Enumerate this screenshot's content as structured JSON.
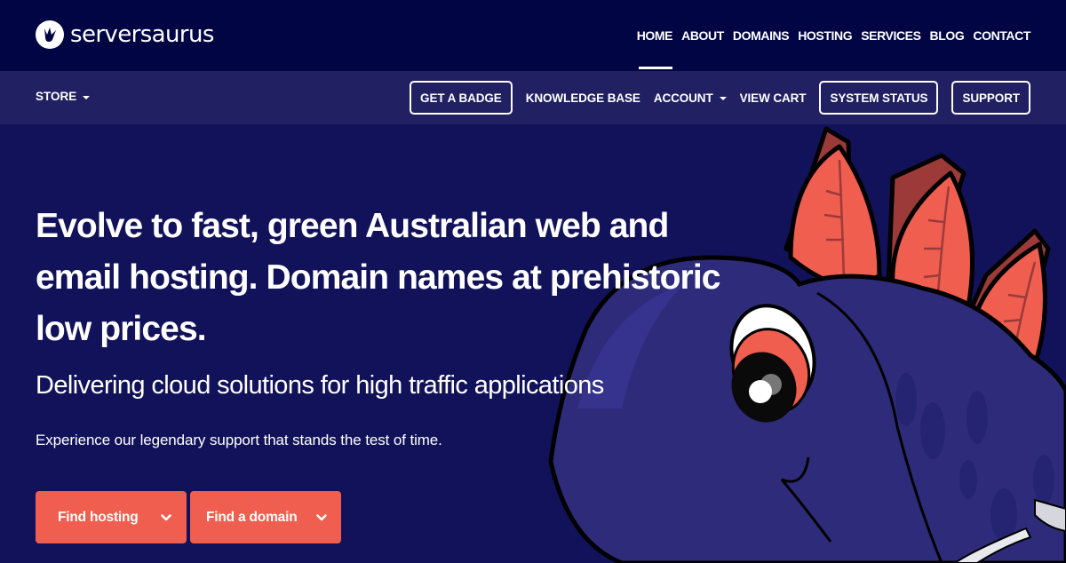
{
  "brand": {
    "name": "serversaurus",
    "logo_icon": "dino-footprint-icon"
  },
  "colors": {
    "header_bg": "#020544",
    "subheader_bg": "#202062",
    "hero_bg": "#12125a",
    "accent": "#ef5e4e",
    "dino_body": "#2e2c7a",
    "dino_plate": "#ef5e4e",
    "dino_plate_side": "#9c3a3a"
  },
  "main_nav": {
    "items": [
      {
        "label": "HOME",
        "active": true
      },
      {
        "label": "ABOUT"
      },
      {
        "label": "DOMAINS"
      },
      {
        "label": "HOSTING"
      },
      {
        "label": "SERVICES"
      },
      {
        "label": "BLOG"
      },
      {
        "label": "CONTACT"
      }
    ]
  },
  "sub_nav": {
    "store": {
      "label": "STORE",
      "icon": "caret-down-icon"
    },
    "items": [
      {
        "label": "GET A BADGE",
        "boxed": true
      },
      {
        "label": "KNOWLEDGE BASE"
      },
      {
        "label": "ACCOUNT",
        "icon": "caret-down-icon"
      },
      {
        "label": "VIEW CART"
      },
      {
        "label": "SYSTEM STATUS",
        "boxed": true
      },
      {
        "label": "SUPPORT",
        "boxed": true
      }
    ]
  },
  "hero": {
    "title": "Evolve to fast, green Australian web and email hosting. Domain names at prehistoric low prices.",
    "subtitle": "Delivering cloud solutions for high traffic applications",
    "tagline": "Experience our legendary support that stands the test of time.",
    "buttons": [
      {
        "label": "Find hosting",
        "icon": "chevron-down-icon"
      },
      {
        "label": "Find a domain",
        "icon": "chevron-down-icon"
      }
    ],
    "illustration": "stegosaurus-mascot"
  }
}
